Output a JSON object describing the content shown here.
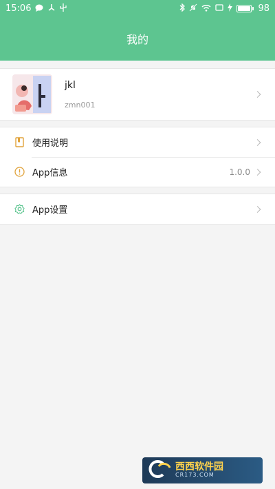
{
  "status_bar": {
    "time": "15:06",
    "battery": "98",
    "icons": [
      "chat-icon",
      "usb-share-icon",
      "usb-icon",
      "bluetooth-icon",
      "mute-icon",
      "wifi-icon",
      "screen-icon",
      "charging-icon",
      "battery-icon"
    ]
  },
  "header": {
    "title": "我的"
  },
  "profile": {
    "name": "jkl",
    "id": "zmn001",
    "icon": "avatar-illustration"
  },
  "menu": [
    {
      "label": "使用说明",
      "value": "",
      "icon": "book-icon"
    },
    {
      "label": "App信息",
      "value": "1.0.0",
      "icon": "info-icon"
    }
  ],
  "settings": [
    {
      "label": "App设置",
      "value": "",
      "icon": "gear-icon"
    }
  ],
  "colors": {
    "primary": "#5dc590",
    "icon_accent": "#e0a23a",
    "settings_icon": "#5dc590",
    "background": "#f4f4f4"
  },
  "watermark": {
    "brand": "西西软件园",
    "url": "CR173.COM"
  }
}
